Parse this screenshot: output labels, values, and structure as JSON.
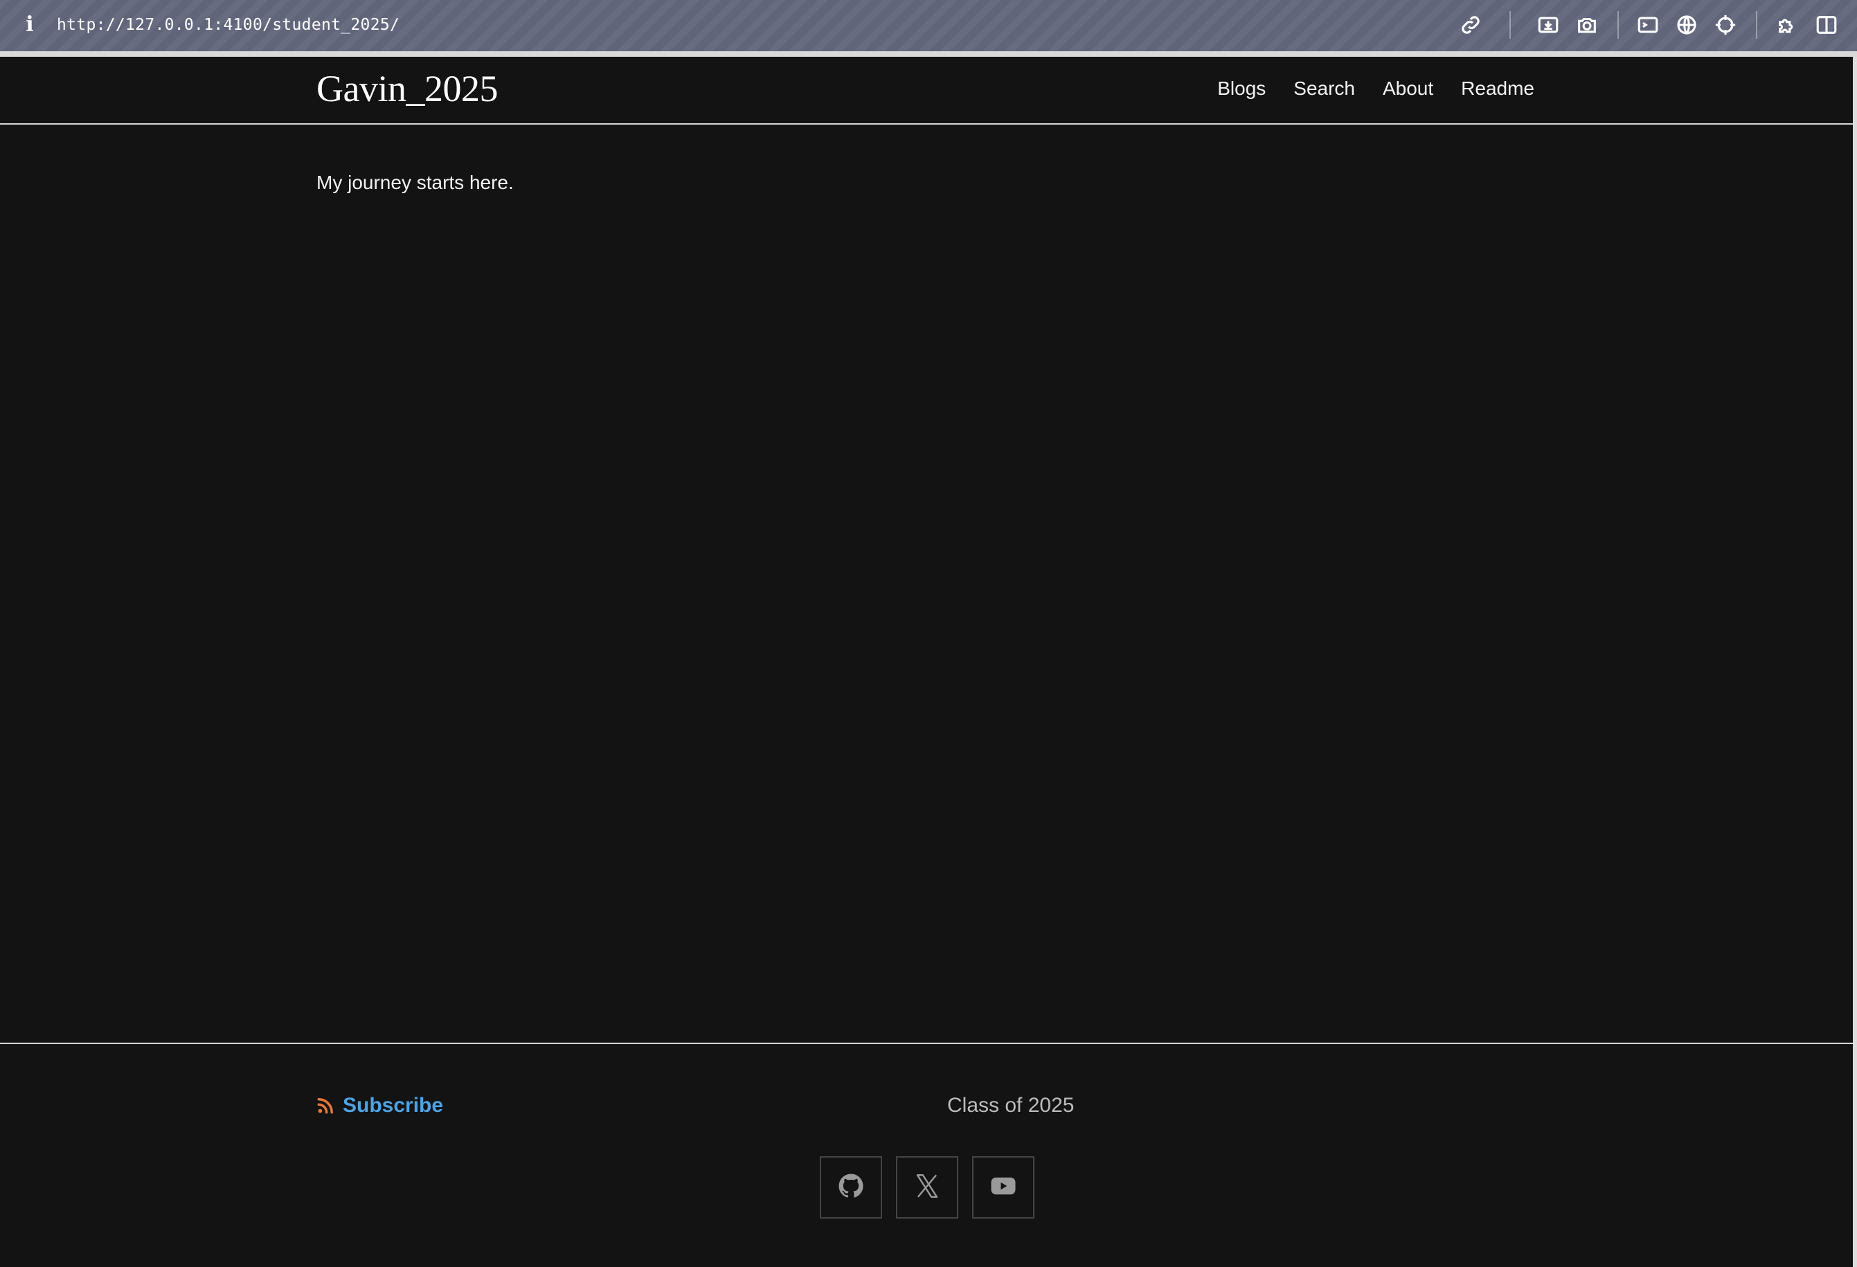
{
  "browser": {
    "info_icon": "i",
    "url": "http://127.0.0.1:4100/student_2025/",
    "toolbar_icons": [
      "link-icon",
      "download-screenshot-icon",
      "camera-icon",
      "terminal-icon",
      "globe-icon",
      "crosshair-icon",
      "extensions-icon",
      "sidebar-icon"
    ]
  },
  "header": {
    "title": "Gavin_2025",
    "nav": [
      {
        "label": "Blogs"
      },
      {
        "label": "Search"
      },
      {
        "label": "About"
      },
      {
        "label": "Readme"
      }
    ]
  },
  "main": {
    "text": "My journey starts here."
  },
  "footer": {
    "subscribe_label": "Subscribe",
    "note": "Class of 2025",
    "socials": [
      {
        "icon": "github-icon"
      },
      {
        "icon": "x-twitter-icon"
      },
      {
        "icon": "youtube-icon"
      }
    ]
  },
  "colors": {
    "page_background": "#131313",
    "text": "#f2f2f2",
    "link_accent": "#4ea3e3",
    "rss_orange": "#e8793a",
    "browser_bar": "#61657a"
  }
}
